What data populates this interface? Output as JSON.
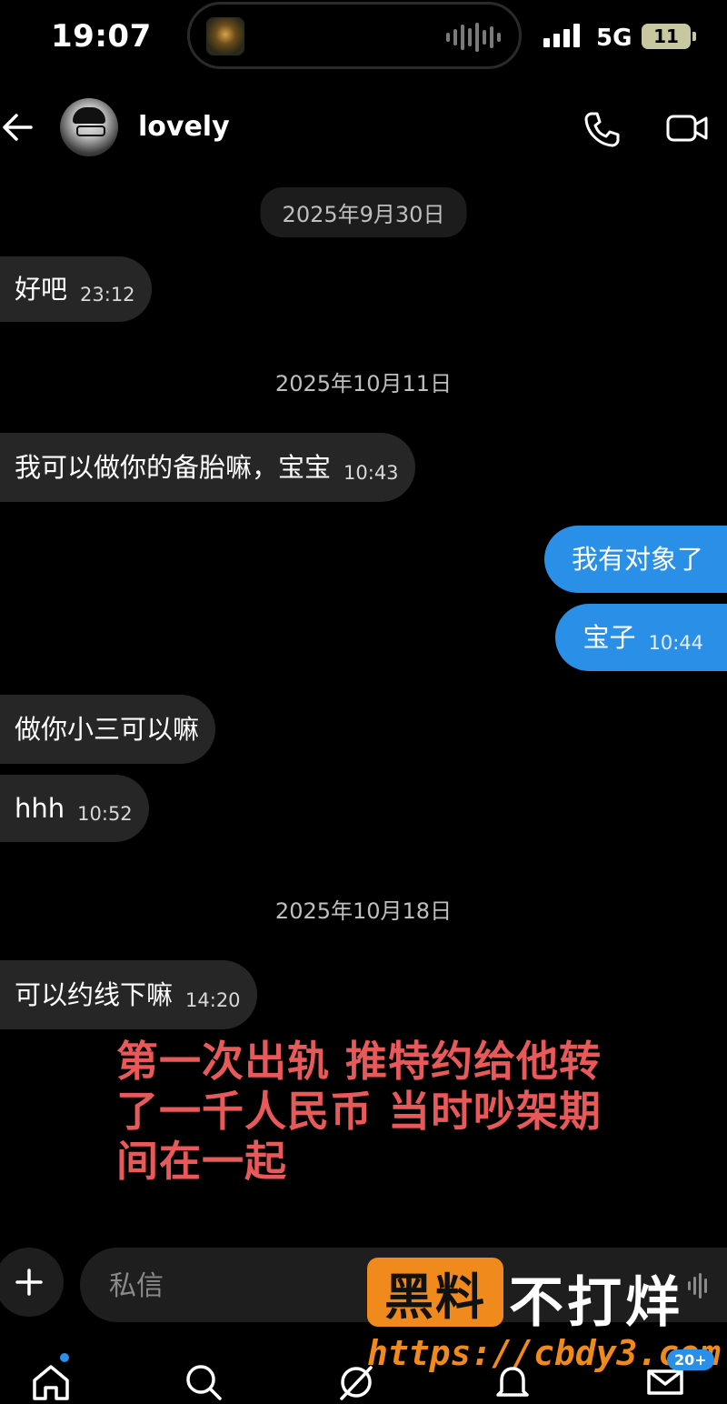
{
  "status_bar": {
    "time": "19:07",
    "network": "5G",
    "battery": "11"
  },
  "header": {
    "contact_name": "lovely",
    "icons": [
      "back-arrow-icon",
      "phone-icon",
      "video-camera-icon"
    ]
  },
  "conversation": {
    "dates": [
      "2025年9月30日",
      "2025年10月11日",
      "2025年10月18日"
    ],
    "messages": [
      {
        "direction": "in",
        "text": "好吧",
        "time": "23:12"
      },
      {
        "direction": "in",
        "text": "我可以做你的备胎嘛，宝宝",
        "time": "10:43"
      },
      {
        "direction": "out",
        "text": "我有对象了",
        "time": ""
      },
      {
        "direction": "out",
        "text": "宝子",
        "time": "10:44"
      },
      {
        "direction": "in",
        "text": "做你小三可以嘛",
        "time": ""
      },
      {
        "direction": "in",
        "text": "hhh",
        "time": "10:52"
      },
      {
        "direction": "in",
        "text": "可以约线下嘛",
        "time": "14:20"
      }
    ]
  },
  "overlay": {
    "caption_line1": "第一次出轨 推特约给他转",
    "caption_line2": "了一千人民币 当时吵架期",
    "caption_line3": "间在一起",
    "caption_color": "#e8595a"
  },
  "composer": {
    "placeholder": "私信"
  },
  "watermark": {
    "box_text": "黑料",
    "text": "不打烊",
    "url": "https://cbdy3.com"
  },
  "bottom_nav": {
    "items": [
      "home-icon",
      "search-icon",
      "grok-icon",
      "notifications-icon",
      "messages-icon"
    ],
    "messages_badge": "20+"
  },
  "colors": {
    "background": "#000000",
    "incoming_bubble": "#262626",
    "outgoing_bubble": "#2a8fe6",
    "accent": "#2a8fe6",
    "watermark_orange": "#f08a1d"
  }
}
